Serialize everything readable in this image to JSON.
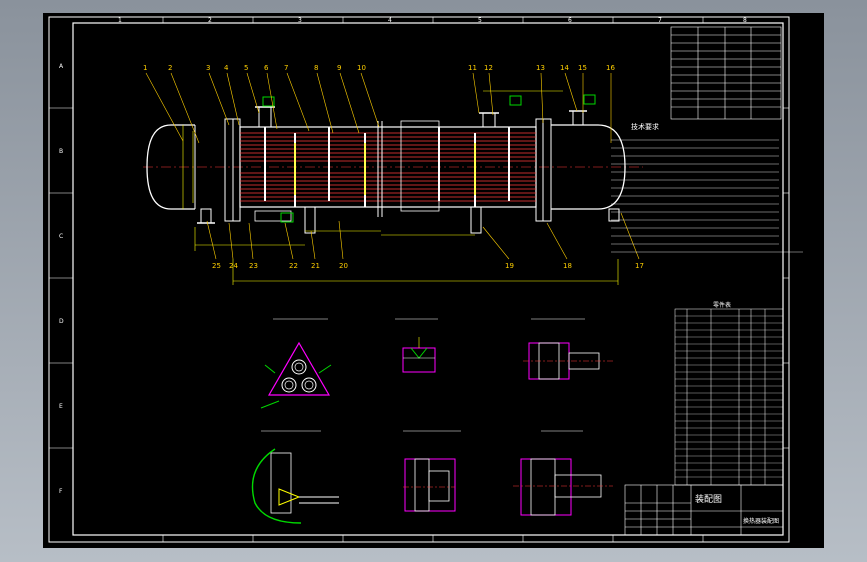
{
  "drawing": {
    "title_block": {
      "drawing_name": "装配图",
      "drawing_subtitle": "换热器装配图"
    },
    "section_heading": "技术要求",
    "part_list_heading": "零件表",
    "detail_titles": [
      "",
      "",
      "",
      "",
      "",
      ""
    ],
    "balloons": [
      "1",
      "2",
      "3",
      "4",
      "5",
      "6",
      "7",
      "8",
      "9",
      "10",
      "11",
      "12",
      "13",
      "14",
      "15",
      "16",
      "17",
      "18",
      "19",
      "20",
      "21",
      "22",
      "23",
      "24",
      "25"
    ],
    "frame_letters": [
      "A",
      "B",
      "C",
      "D",
      "E",
      "F"
    ],
    "frame_numbers": [
      "1",
      "2",
      "3",
      "4",
      "5",
      "6",
      "7",
      "8"
    ],
    "colors": {
      "background": "#000000",
      "frame": "#ffffff",
      "tubes": "#ff3b3b",
      "dims": "#ffff00",
      "leaders": "#ffd000",
      "green": "#00d800",
      "magenta": "#ff00ff",
      "cyan": "#00ffff"
    }
  }
}
